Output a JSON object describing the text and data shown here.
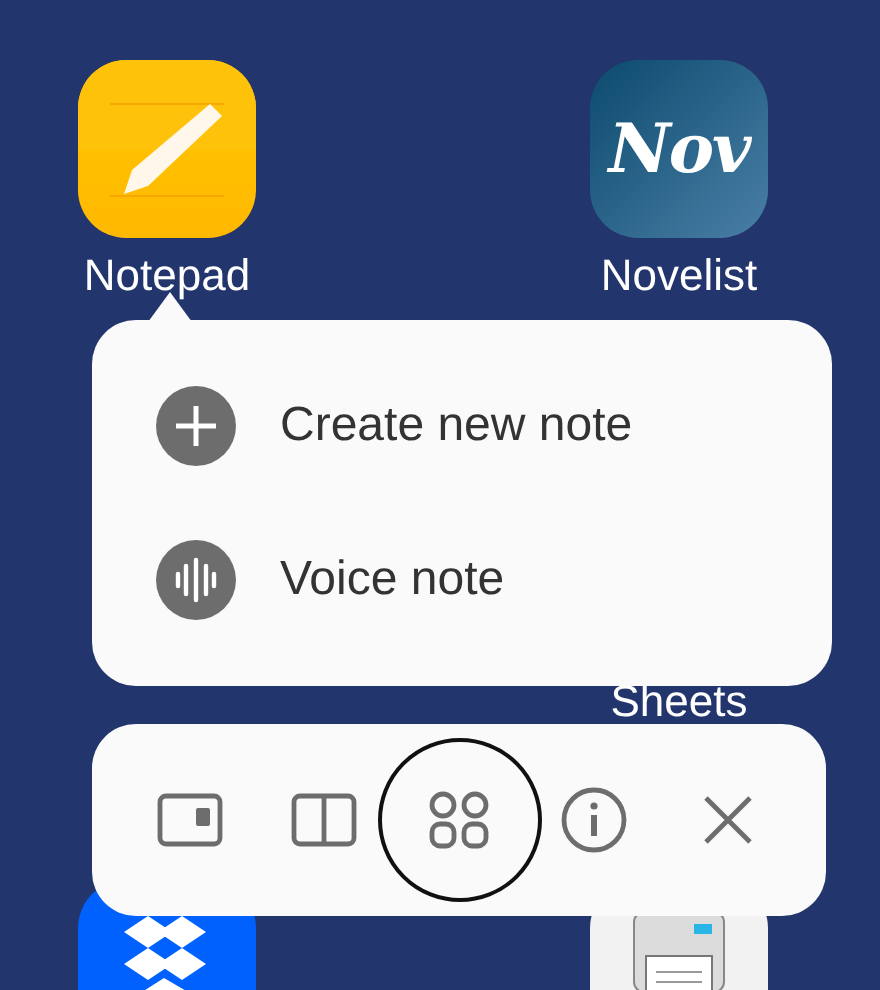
{
  "apps": [
    {
      "kind": "notepad",
      "label": "Notepad"
    },
    {
      "kind": "novelist",
      "label": "Novelist",
      "logo_text": "Nov"
    },
    {
      "kind": "sheets",
      "label": "Sheets"
    },
    {
      "kind": "dropbox"
    },
    {
      "kind": "printer"
    }
  ],
  "shortcut_menu": {
    "items": [
      {
        "kind": "add",
        "label": "Create new note"
      },
      {
        "kind": "voice",
        "label": "Voice note"
      }
    ]
  },
  "action_bar": {
    "buttons": [
      {
        "kind": "popup",
        "highlighted": false
      },
      {
        "kind": "split",
        "highlighted": false
      },
      {
        "kind": "apps",
        "highlighted": true
      },
      {
        "kind": "info",
        "highlighted": false
      },
      {
        "kind": "close",
        "highlighted": false
      }
    ]
  }
}
